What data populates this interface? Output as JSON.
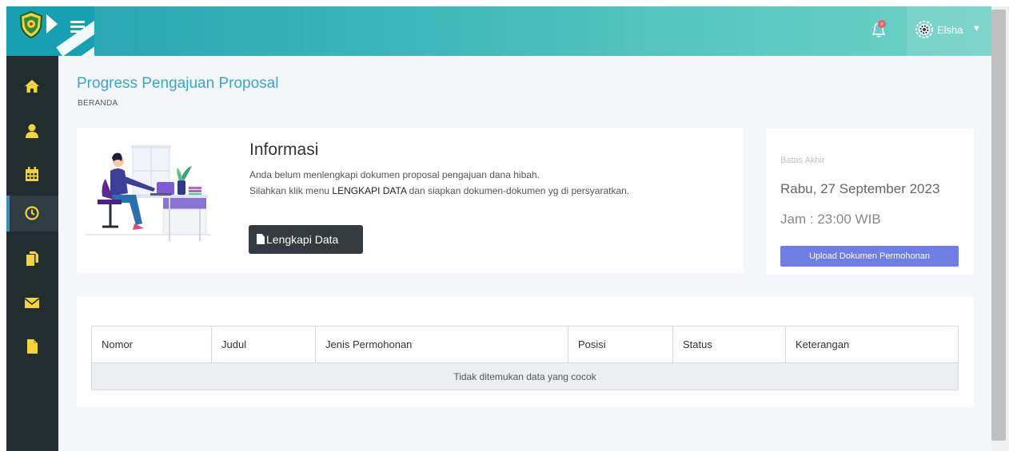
{
  "header": {
    "user_name": "Elsha",
    "colors": {
      "topbar_start": "#26a3b2",
      "topbar_end": "#6dd1c4",
      "notification_dot": "#e25d6c"
    },
    "icons": {
      "menu": "hamburger-icon",
      "notification": "bell-icon",
      "user": "gear-avatar-icon",
      "caret": "chevron-down-icon"
    }
  },
  "sidebar": {
    "items": [
      {
        "icon": "home-icon",
        "color": "#f5d33a"
      },
      {
        "icon": "user-icon",
        "color": "#f5d33a"
      },
      {
        "icon": "calendar-icon",
        "color": "#f5d33a"
      },
      {
        "icon": "clock-icon",
        "color": "#f5d33a",
        "active": true
      },
      {
        "icon": "copy-icon",
        "color": "#f5d33a"
      },
      {
        "icon": "envelope-icon",
        "color": "#f5d33a"
      },
      {
        "icon": "file-icon",
        "color": "#f5d33a"
      }
    ]
  },
  "page": {
    "title": "Progress Pengajuan Proposal",
    "breadcrumb": "BERANDA"
  },
  "info": {
    "title": "Informasi",
    "line1": "Anda belum menlengkapi dokumen proposal pengajuan dana hibah.",
    "line2_prefix": "Silahkan klik menu ",
    "line2_bold": "LENGKAPI DATA",
    "line2_suffix": " dan siapkan dokumen-dokumen yg di persyaratkan.",
    "button_label": "Lengkapi Data"
  },
  "deadline": {
    "label": "Batas Akhir",
    "date": "Rabu, 27 September 2023",
    "time": "Jam : 23:00 WIB",
    "button_label": "Upload Dokumen Permohonan",
    "button_color": "#6f7ee3"
  },
  "table": {
    "columns": [
      "Nomor",
      "Judul",
      "Jenis Permohonan",
      "Posisi",
      "Status",
      "Keterangan"
    ],
    "empty_message": "Tidak ditemukan data yang cocok"
  }
}
